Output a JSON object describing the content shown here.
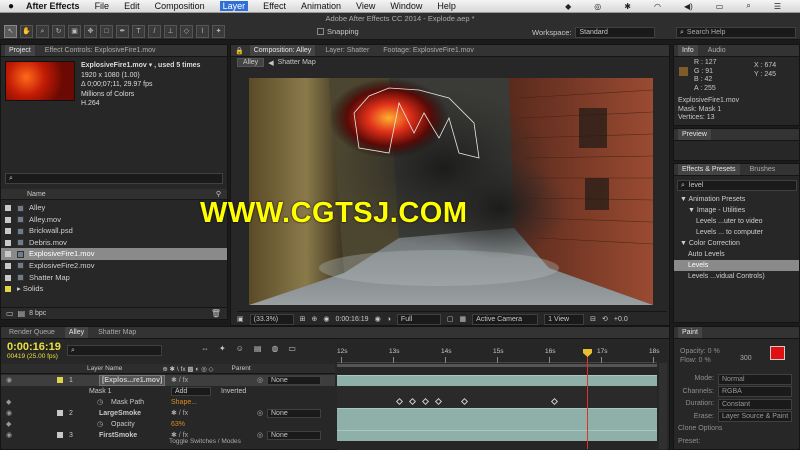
{
  "menubar": {
    "apple": "",
    "app": "After Effects",
    "items": [
      "File",
      "Edit",
      "Composition",
      "Layer",
      "Effect",
      "Animation",
      "View",
      "Window",
      "Help"
    ],
    "active": "Layer"
  },
  "window": {
    "title": "Adobe After Effects CC 2014 - Explode.aep *"
  },
  "toolbar": {
    "snapping": "Snapping",
    "workspace_label": "Workspace:",
    "workspace_value": "Standard",
    "search_placeholder": "Search Help"
  },
  "project": {
    "tabs": [
      "Project",
      "Effect Controls: ExplosiveFire1.mov"
    ],
    "info_name": "ExplosiveFire1.mov ▾ , used 5 times",
    "info_res": "1920 x 1080 (1.00)",
    "info_dur": "Δ 0;00;07;11, 29.97 fps",
    "info_colors": "Millions of Colors",
    "info_codec": "H.264",
    "col_name": "Name",
    "items": [
      {
        "name": "Alley",
        "type": "comp",
        "color": "#c9c9c9"
      },
      {
        "name": "Alley.mov",
        "type": "file",
        "color": "#c9c9c9"
      },
      {
        "name": "Brickwall.psd",
        "type": "file",
        "color": "#c9c9c9"
      },
      {
        "name": "Debris.mov",
        "type": "file",
        "color": "#c9c9c9"
      },
      {
        "name": "ExplosiveFire1.mov",
        "type": "file",
        "color": "#c9c9c9"
      },
      {
        "name": "ExplosiveFire2.mov",
        "type": "file",
        "color": "#c9c9c9"
      },
      {
        "name": "Shatter Map",
        "type": "comp",
        "color": "#c9c9c9"
      },
      {
        "name": "Solids",
        "type": "folder",
        "color": "#e0d44a"
      }
    ],
    "selected_index": 4,
    "bpc": "8 bpc"
  },
  "composition": {
    "tabs": [
      "Composition: Alley",
      "Layer: Shatter",
      "Footage: ExplosiveFire1.mov"
    ],
    "subtabs": [
      "Alley",
      "Shatter Map"
    ],
    "zoom": "(33.3%)",
    "timecode": "0:00:16:19",
    "resolution": "Full",
    "camera": "Active Camera",
    "views": "1 View"
  },
  "watermark": "WWW.CGTSJ.COM",
  "info": {
    "tabs": [
      "Info",
      "Audio"
    ],
    "r": "R : 127",
    "g": "G : 91",
    "b": "B : 42",
    "a": "A : 255",
    "x": "X : 674",
    "y": "Y : 245",
    "line1": "ExplosiveFire1.mov",
    "line2": "Mask: Mask 1",
    "line3": "Vertices: 13"
  },
  "preview": {
    "tab": "Preview"
  },
  "effects": {
    "tabs": [
      "Effects & Presets",
      "Brushes"
    ],
    "search": "level",
    "tree": [
      {
        "text": "▼ Animation Presets",
        "indent": 0
      },
      {
        "text": "▼ Image - Utilities",
        "indent": 1
      },
      {
        "text": "Levels ...uter to video",
        "indent": 2
      },
      {
        "text": "Levels ... to computer",
        "indent": 2
      },
      {
        "text": "▼ Color Correction",
        "indent": 0
      },
      {
        "text": "Auto Levels",
        "indent": 1
      },
      {
        "text": "Levels",
        "indent": 1,
        "sel": true
      },
      {
        "text": "Levels ...vidual Controls)",
        "indent": 1
      }
    ]
  },
  "timeline": {
    "tabs": [
      "Render Queue",
      "Alley",
      "Shatter Map"
    ],
    "timecode": "0:00:16:19",
    "frames": "00419 (25.00 fps)",
    "col_layer": "Layer Name",
    "col_parent": "Parent",
    "ruler": [
      "12s",
      "13s",
      "14s",
      "15s",
      "16s",
      "17s",
      "18s"
    ],
    "rows": [
      {
        "num": "1",
        "name": "[Explos...re1.mov]",
        "kind": "layer",
        "parent": "None",
        "sel": true
      },
      {
        "num": "",
        "name": "Mask 1",
        "kind": "mask",
        "mode": "Add",
        "inv": "Inverted"
      },
      {
        "num": "",
        "name": "Mask Path",
        "kind": "prop",
        "value": "Shape..."
      },
      {
        "num": "2",
        "name": "LargeSmoke",
        "kind": "layer",
        "parent": "None"
      },
      {
        "num": "",
        "name": "Opacity",
        "kind": "prop",
        "value": "63%"
      },
      {
        "num": "3",
        "name": "FirstSmoke",
        "kind": "layer",
        "parent": "None"
      }
    ],
    "toggle": "Toggle Switches / Modes"
  },
  "paint": {
    "tab": "Paint",
    "opacity": "Opacity: 0 %",
    "flow": "Flow: 0 %",
    "size": "300",
    "mode_label": "Mode:",
    "mode_value": "Normal",
    "channels_label": "Channels:",
    "channels_value": "RGBA",
    "duration_label": "Duration:",
    "duration_value": "Constant",
    "erase_label": "Erase:",
    "erase_value": "Layer Source & Paint",
    "clone": "Clone Options",
    "preset": "Preset:"
  },
  "colors": {
    "accent": "#e8e040",
    "playhead": "#e03030",
    "track": "#8fb0a8",
    "swatch": "#e01010"
  }
}
